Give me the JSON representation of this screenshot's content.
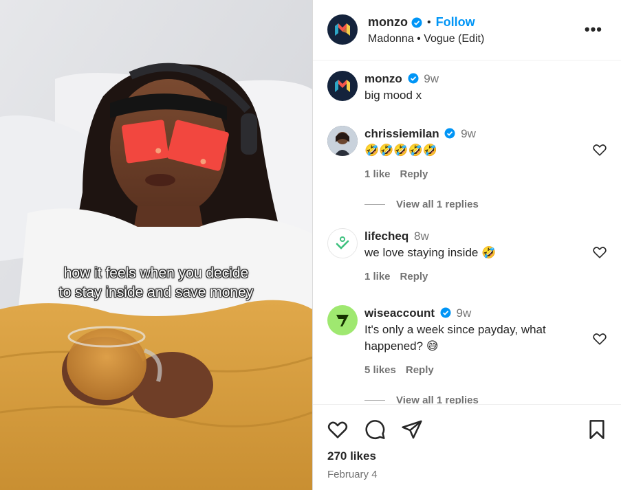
{
  "media": {
    "caption_line1": "how it feels when you decide",
    "caption_line2": "to stay inside and save money"
  },
  "post": {
    "author": "monzo",
    "follow_label": "Follow",
    "audio": "Madonna • Vogue (Edit)",
    "more_label": "•••"
  },
  "comments": [
    {
      "user": "monzo",
      "time": "9w",
      "text": "big mood x"
    },
    {
      "user": "chrissiemilan",
      "time": "9w",
      "text": "🤣🤣🤣🤣🤣",
      "likes": "1 like",
      "reply": "Reply",
      "view_replies": "View all 1 replies"
    },
    {
      "user": "lifecheq",
      "time": "8w",
      "text": "we love staying inside 🤣",
      "likes": "1 like",
      "reply": "Reply"
    },
    {
      "user": "wiseaccount",
      "time": "9w",
      "text": "It's only a week since payday, what happened? 😅",
      "likes": "5 likes",
      "reply": "Reply",
      "view_replies": "View all 1 replies"
    }
  ],
  "footer": {
    "likes": "270 likes",
    "date": "February 4"
  },
  "icons": {
    "verified": "verified-badge-icon",
    "heart": "heart-icon",
    "comment": "comment-icon",
    "share": "share-icon",
    "save": "bookmark-icon"
  },
  "colors": {
    "accent": "#0095f6",
    "monzo_bg": "#14233c",
    "wise_bg": "#9fe870",
    "card_red": "#f2473f"
  }
}
